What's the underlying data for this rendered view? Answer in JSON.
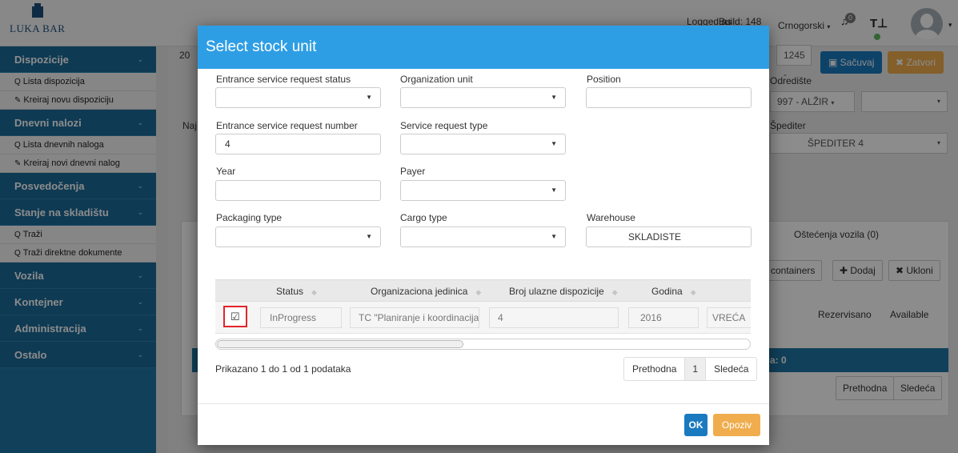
{
  "app": {
    "logo_text": "LUKA BAR",
    "logged_as": "Logged as",
    "build": "Build: 148",
    "language": "Crnogorski",
    "notification_count": "0"
  },
  "sidebar": {
    "sections": [
      {
        "label": "Dispozicije",
        "links": [
          "Lista dispozicija",
          "Kreiraj novu dispoziciju"
        ]
      },
      {
        "label": "Dnevni nalozi",
        "links": [
          "Lista dnevnih naloga",
          "Kreiraj novi dnevni nalog"
        ]
      },
      {
        "label": "Posvedočenja",
        "links": []
      },
      {
        "label": "Stanje na skladištu",
        "links": [
          "Traži",
          "Traži direktne dokumente"
        ]
      },
      {
        "label": "Vozila",
        "links": []
      },
      {
        "label": "Kontejner",
        "links": []
      },
      {
        "label": "Administracija",
        "links": []
      },
      {
        "label": "Ostalo",
        "links": []
      }
    ]
  },
  "background": {
    "save": "Sačuvaj",
    "close": "Zatvori",
    "destination_label": "Odredište",
    "destination_value": "997 - ALŽIR",
    "code_value": "1245 -",
    "forwarder_label": "Špediter",
    "forwarder_value": "ŠPEDITER 4",
    "damage_tab": "Oštećenja vozila (0)",
    "containers_btn": "containers",
    "add_btn": "Dodaj",
    "remove_btn": "Ukloni",
    "reserved_col": "Rezervisano",
    "available_col": "Available",
    "total": "a: 0",
    "prev": "Prethodna",
    "next": "Sledeća",
    "left_cut_top": "20",
    "left_cut_label": "Naj"
  },
  "modal": {
    "title": "Select stock unit",
    "fields": {
      "entrance_status": {
        "label": "Entrance service request status",
        "value": ""
      },
      "organization_unit": {
        "label": "Organization unit",
        "value": ""
      },
      "position": {
        "label": "Position",
        "value": ""
      },
      "entrance_number": {
        "label": "Entrance service request number",
        "value": "4"
      },
      "service_type": {
        "label": "Service request type",
        "value": ""
      },
      "year": {
        "label": "Year",
        "value": ""
      },
      "payer": {
        "label": "Payer",
        "value": ""
      },
      "packaging_type": {
        "label": "Packaging type",
        "value": ""
      },
      "cargo_type": {
        "label": "Cargo type",
        "value": ""
      },
      "warehouse": {
        "label": "Warehouse",
        "value": "SKLADISTE"
      }
    },
    "table": {
      "columns": [
        "Status",
        "Organizaciona jedinica",
        "Broj ulazne dispozicije",
        "Godina"
      ],
      "rows": [
        {
          "status": "InProgress",
          "org_unit": "TC \"Planiranje i koordinacija",
          "entry_number": "4",
          "year": "2016",
          "extra": "VREĆA"
        }
      ]
    },
    "info": "Prikazano 1 do 1 od 1 podataka",
    "pager": {
      "prev": "Prethodna",
      "page": "1",
      "next": "Sledeća"
    },
    "ok": "OK",
    "cancel": "Opoziv"
  },
  "colors": {
    "header_blue": "#2e9ee4",
    "sidebar_blue": "#1f75a4",
    "ok_blue": "#1a7abf",
    "cancel_orange": "#f0ad4e",
    "highlight_red": "#e4242b"
  }
}
